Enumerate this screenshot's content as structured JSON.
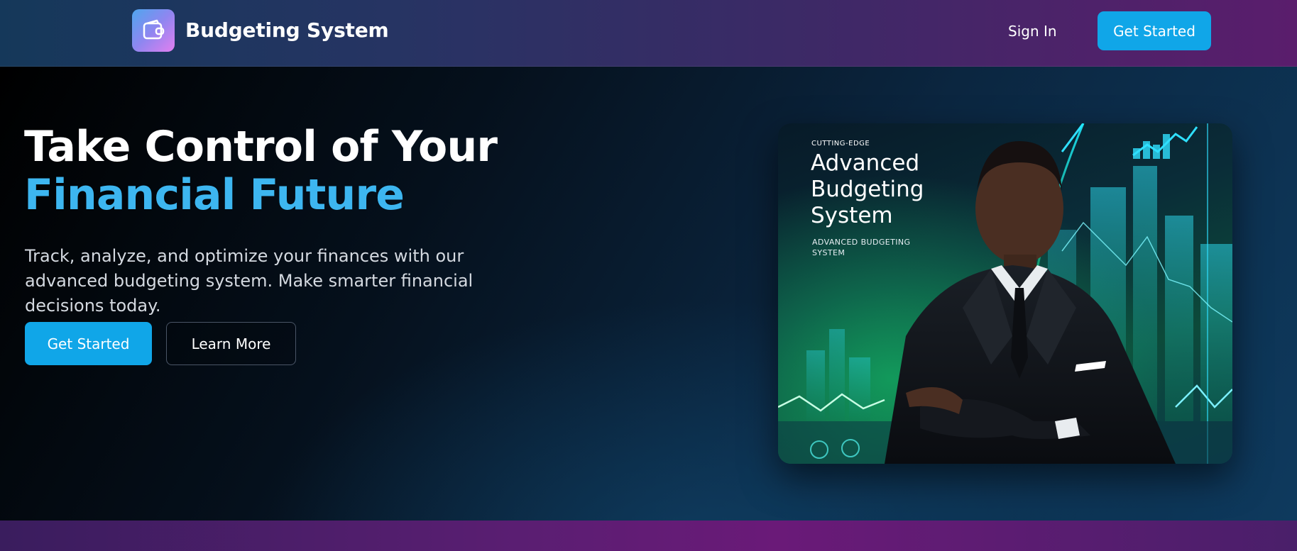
{
  "header": {
    "brand": "Budgeting System",
    "logo_icon": "wallet-icon",
    "signin_label": "Sign In",
    "cta_label": "Get Started"
  },
  "hero": {
    "title_line1": "Take Control of Your",
    "title_line2": "Financial Future",
    "lead": "Track, analyze, and optimize your finances with our advanced budgeting system. Make smarter financial decisions today.",
    "primary_label": "Get Started",
    "secondary_label": "Learn More"
  },
  "hero_image": {
    "kicker": "CUTTING-EDGE",
    "title": "Advanced Budgeting System",
    "subtitle": "ADVANCED BUDGETING SYSTEM"
  },
  "colors": {
    "accent": "#10a6e8",
    "title_highlight": "#3db6f0",
    "header_gradient_start": "#15385a",
    "header_gradient_end": "#5a1d6c"
  }
}
